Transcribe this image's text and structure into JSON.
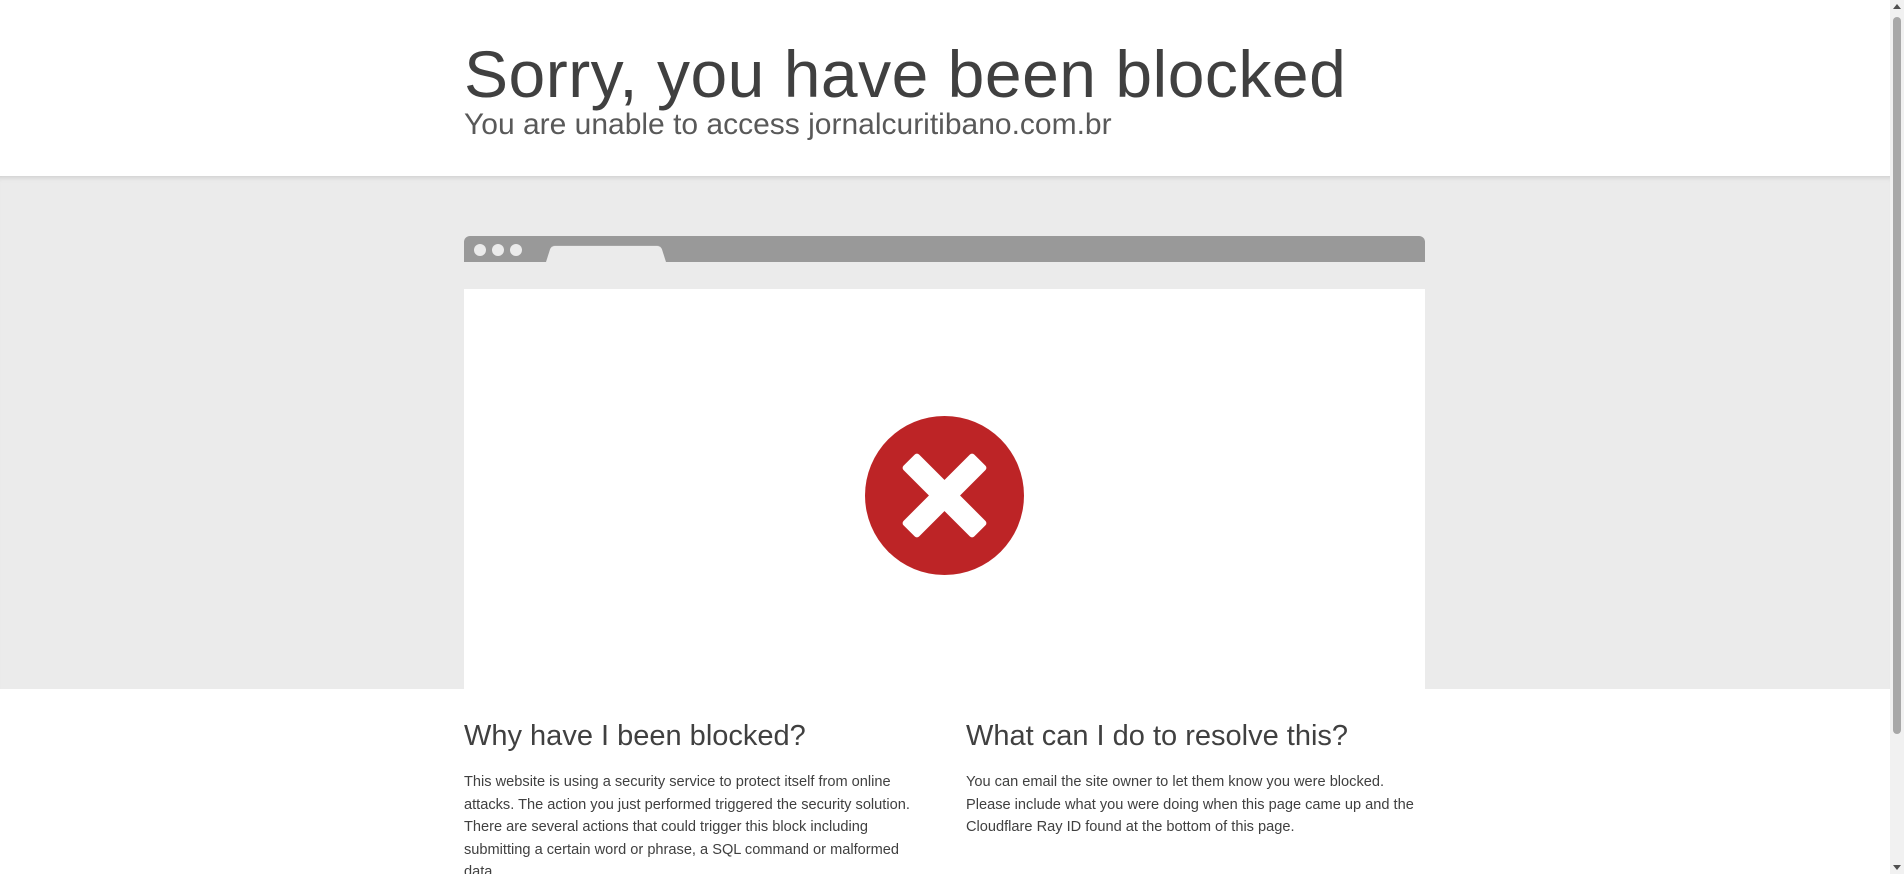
{
  "header": {
    "title": "Sorry, you have been blocked",
    "subtitle": "You are unable to access jornalcuritibano.com.br"
  },
  "illustration": {
    "icon": "error-x-icon",
    "icon_color": "#bd2426",
    "browser_bar_color": "#999999"
  },
  "why": {
    "heading": "Why have I been blocked?",
    "body": "This website is using a security service to protect itself from online attacks. The action you just performed triggered the security solution. There are several actions that could trigger this block including submitting a certain word or phrase, a SQL command or malformed data."
  },
  "resolve": {
    "heading": "What can I do to resolve this?",
    "body": "You can email the site owner to let them know you were blocked. Please include what you were doing when this page came up and the Cloudflare Ray ID found at the bottom of this page."
  }
}
